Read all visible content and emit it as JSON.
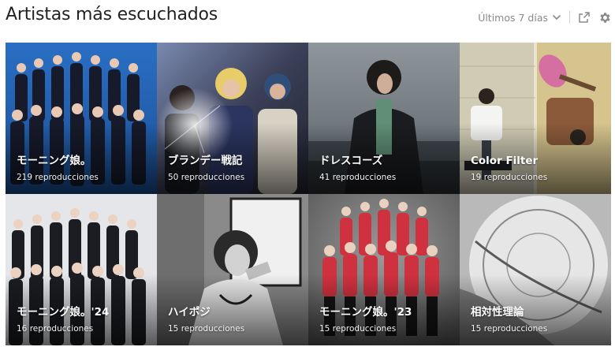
{
  "header": {
    "title": "Artistas más escuchados",
    "period_label": "Últimos 7 días",
    "icons": [
      "chevron-down-icon",
      "share-icon",
      "gear-icon"
    ]
  },
  "colors": {
    "title_text": "#222222",
    "muted_text": "#8a8a8a",
    "tile_text": "#ffffff"
  },
  "artists": [
    {
      "name": "モーニング娘。",
      "plays": "219 reproducciones"
    },
    {
      "name": "ブランデー戦記",
      "plays": "50 reproducciones"
    },
    {
      "name": "ドレスコーズ",
      "plays": "41 reproducciones"
    },
    {
      "name": "Color Filter",
      "plays": "19 reproducciones"
    },
    {
      "name": "モーニング娘。'24",
      "plays": "16 reproducciones"
    },
    {
      "name": "ハイポジ",
      "plays": "15 reproducciones"
    },
    {
      "name": "モーニング娘。'23",
      "plays": "15 reproducciones"
    },
    {
      "name": "相対性理論",
      "plays": "15 reproducciones"
    }
  ]
}
